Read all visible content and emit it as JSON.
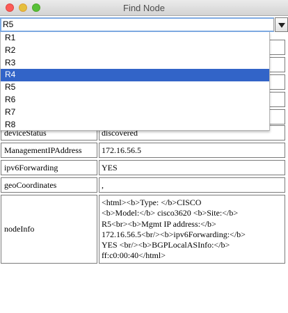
{
  "window": {
    "title": "Find Node"
  },
  "search": {
    "value": "R5"
  },
  "dropdown": {
    "options": [
      "R1",
      "R2",
      "R3",
      "R4",
      "R5",
      "R6",
      "R7",
      "R8"
    ],
    "highlighted": "R4"
  },
  "table": {
    "rows": [
      {
        "key": "",
        "value": ""
      },
      {
        "key": "",
        "value": ""
      },
      {
        "key": "",
        "value": ""
      },
      {
        "key": "",
        "value": ""
      },
      {
        "key": "",
        "value": ""
      },
      {
        "key": "deviceStatus",
        "value": "discovered"
      },
      {
        "key": "ManagementIPAddress",
        "value": "172.16.56.5"
      },
      {
        "key": "ipv6Forwarding",
        "value": "YES"
      },
      {
        "key": "geoCoordinates",
        "value": ","
      },
      {
        "key": "nodeInfo",
        "value": "<html><b>Type: </b>CISCO\n<b>Model:</b> cisco3620 <b>Site:</b>\nR5<br><b>Mgmt IP address:</b>\n172.16.56.5<br/><b>ipv6Forwarding:</b>\nYES <br/><b>BGPLocalASInfo:</b>\nff:c0:00:40</html>"
      }
    ]
  }
}
